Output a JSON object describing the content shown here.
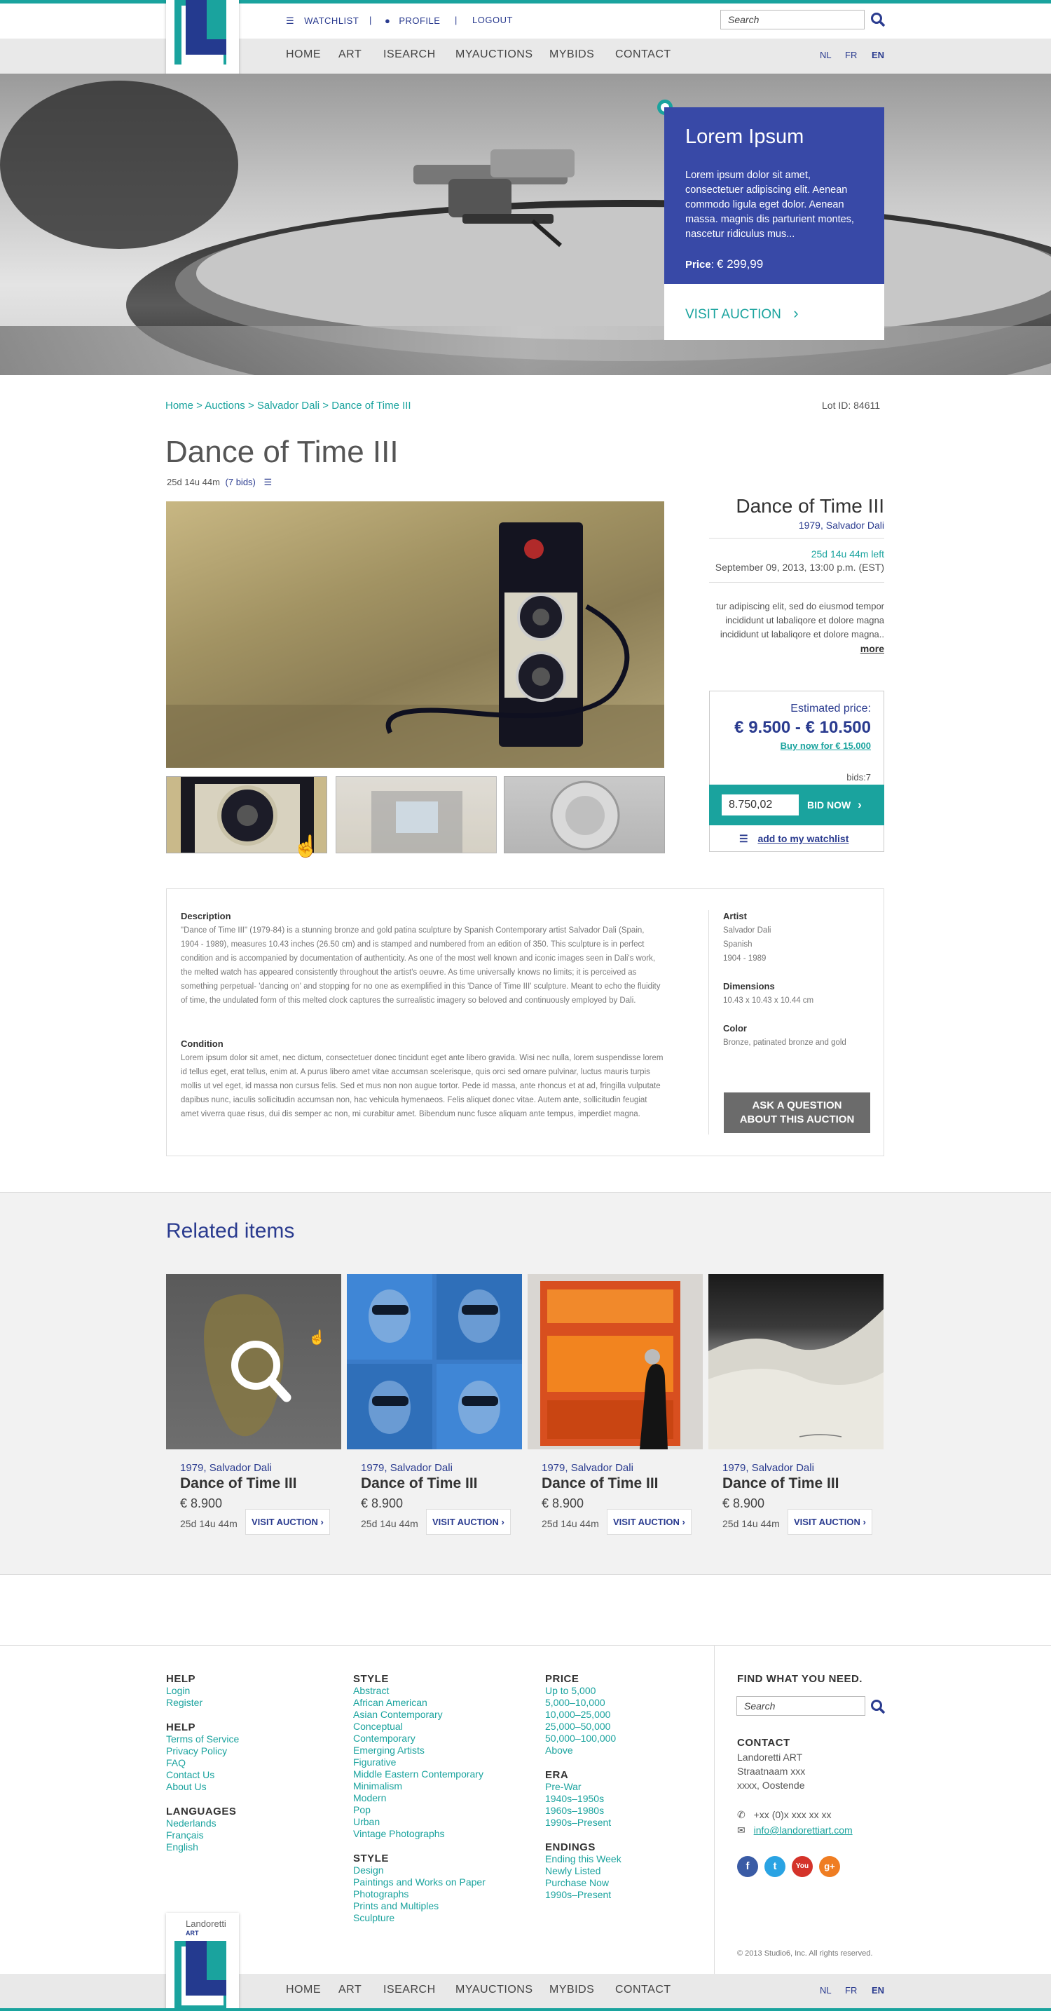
{
  "header": {
    "logo_name": "Landoretti",
    "logo_sub": "ART",
    "top_links": [
      "WATCHLIST",
      "PROFILE",
      "LOGOUT"
    ],
    "search_placeholder": "Search",
    "nav": [
      "HOME",
      "ART",
      "ISEARCH",
      "MYAUCTIONS",
      "MYBIDS",
      "CONTACT"
    ],
    "languages": [
      "NL",
      "FR",
      "EN"
    ]
  },
  "hero": {
    "title": "Lorem Ipsum",
    "text": "Lorem ipsum dolor sit amet, consectetuer adipiscing elit. Aenean commodo ligula eget dolor. Aenean massa. magnis dis parturient montes, nascetur ridiculus mus...",
    "price_label": "Price",
    "price_value": "€ 299,99",
    "cta": "VISIT AUCTION"
  },
  "breadcrumb": "Home > Auctions > Salvador Dali > Dance of Time III",
  "lot_id": "Lot ID: 84611",
  "item": {
    "title": "Dance of Time III",
    "time_left": "25d 14u 44m",
    "bids_link": "(7 bids)",
    "side_title": "Dance of Time III",
    "side_meta": "1979, Salvador Dali",
    "side_left": "25d 14u 44m left",
    "side_date": "September 09, 2013, 13:00 p.m. (EST)",
    "side_excerpt": "tur adipiscing elit, sed do eiusmod tempor incididunt ut labaliqore et dolore magna incididunt ut labaliqore et dolore magna..",
    "more": "more",
    "estimate_label": "Estimated price:",
    "estimate_value": "€ 9.500 - € 10.500",
    "buy_now": "Buy now for € 15.000",
    "bids_count": "bids:7",
    "bid_input": "8.750,02",
    "bid_button": "BID NOW",
    "watchlist": "add to my watchlist"
  },
  "details": {
    "desc_title": "Description",
    "desc_text": "\"Dance of Time III\" (1979-84) is a stunning bronze and gold patina sculpture by Spanish Contemporary artist Salvador Dali (Spain, 1904 - 1989), measures 10.43 inches (26.50 cm) and is stamped and numbered from an edition of 350. This sculpture is in perfect condition and is accompanied by documentation of authenticity. As one of the most well known and iconic images seen in Dali's work, the melted watch has appeared consistently throughout the artist's oeuvre. As time universally knows no limits; it is perceived as something perpetual- 'dancing on' and stopping for no one as exemplified in this 'Dance of Time III' sculpture. Meant to echo the fluidity of time, the undulated form of this melted clock captures the surrealistic imagery so beloved and continuously employed by Dali.",
    "cond_title": "Condition",
    "cond_text": "Lorem ipsum dolor sit amet, nec dictum, consectetuer donec tincidunt eget ante libero gravida. Wisi nec nulla, lorem suspendisse lorem id tellus eget, erat tellus, enim at. A purus libero amet vitae accumsan scelerisque, quis orci sed ornare pulvinar, luctus mauris turpis mollis ut vel eget, id massa non cursus felis. Sed et mus non non augue tortor. Pede id massa, ante rhoncus et at ad, fringilla vulputate dapibus nunc, iaculis sollicitudin accumsan non, hac vehicula hymenaeos. Felis aliquet donec vitae. Autem ante, sollicitudin feugiat amet viverra quae risus, dui dis semper ac non, mi curabitur amet. Bibendum nunc fusce aliquam ante tempus, imperdiet magna.",
    "artist_title": "Artist",
    "artist_lines": [
      "Salvador Dali",
      "Spanish",
      "1904 - 1989"
    ],
    "dim_title": "Dimensions",
    "dim_text": "10.43 x 10.43 x 10.44 cm",
    "color_title": "Color",
    "color_text": "Bronze, patinated bronze and gold",
    "ask_line1": "ASK A QUESTION",
    "ask_line2": "ABOUT THIS AUCTION"
  },
  "related": {
    "title": "Related items",
    "items": [
      {
        "meta": "1979, Salvador Dali",
        "title": "Dance of Time III",
        "price": "€ 8.900",
        "time": "25d 14u 44m",
        "cta": "VISIT AUCTION"
      },
      {
        "meta": "1979, Salvador Dali",
        "title": "Dance of Time III",
        "price": "€ 8.900",
        "time": "25d 14u 44m",
        "cta": "VISIT AUCTION"
      },
      {
        "meta": "1979, Salvador Dali",
        "title": "Dance of Time III",
        "price": "€ 8.900",
        "time": "25d 14u 44m",
        "cta": "VISIT AUCTION"
      },
      {
        "meta": "1979, Salvador Dali",
        "title": "Dance of Time III",
        "price": "€ 8.900",
        "time": "25d 14u 44m",
        "cta": "VISIT AUCTION"
      }
    ]
  },
  "footer": {
    "col1": [
      {
        "title": "HELP",
        "links": [
          "Login",
          "Register"
        ]
      },
      {
        "title": "HELP",
        "links": [
          "Terms of Service",
          "Privacy Policy",
          "FAQ",
          "Contact Us",
          "About Us"
        ]
      },
      {
        "title": "LANGUAGES",
        "links": [
          "Nederlands",
          "Français",
          "English"
        ]
      }
    ],
    "col2": [
      {
        "title": "STYLE",
        "links": [
          "Abstract",
          "African American",
          "Asian Contemporary",
          "Conceptual",
          "Contemporary",
          "Emerging Artists",
          "Figurative",
          "Middle Eastern Contemporary",
          "Minimalism",
          "Modern",
          "Pop",
          "Urban",
          "Vintage Photographs"
        ]
      },
      {
        "title": "STYLE",
        "links": [
          "Design",
          "Paintings and Works on Paper",
          "Photographs",
          "Prints and Multiples",
          "Sculpture"
        ]
      }
    ],
    "col3": [
      {
        "title": "PRICE",
        "links": [
          "Up to 5,000",
          "5,000–10,000",
          "10,000–25,000",
          "25,000–50,000",
          "50,000–100,000",
          "Above"
        ]
      },
      {
        "title": "ERA",
        "links": [
          "Pre-War",
          "1940s–1950s",
          "1960s–1980s",
          "1990s–Present"
        ]
      },
      {
        "title": "ENDINGS",
        "links": [
          "Ending this Week",
          "Newly Listed",
          "Purchase Now",
          "1990s–Present"
        ]
      }
    ],
    "find_title": "FIND WHAT YOU NEED.",
    "search_placeholder": "Search",
    "contact_title": "CONTACT",
    "contact_lines": [
      "Landoretti ART",
      "Straatnaam xxx",
      "xxxx, Oostende"
    ],
    "phone": "+xx (0)x xxx xx xx",
    "email": "info@landorettiart.com",
    "social": [
      "f",
      "t",
      "You",
      "g+"
    ],
    "copyright": "© 2013 Studio6, Inc. All rights reserved."
  }
}
